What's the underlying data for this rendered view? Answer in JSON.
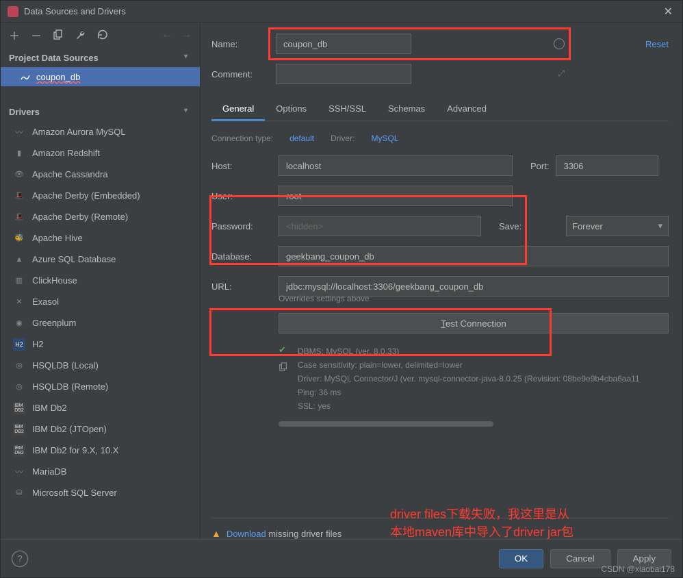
{
  "window": {
    "title": "Data Sources and Drivers"
  },
  "sidebar": {
    "sections": {
      "project": "Project Data Sources",
      "drivers": "Drivers"
    },
    "project_items": [
      {
        "label": "coupon_db"
      }
    ],
    "drivers_list": [
      {
        "label": "Amazon Aurora MySQL"
      },
      {
        "label": "Amazon Redshift"
      },
      {
        "label": "Apache Cassandra"
      },
      {
        "label": "Apache Derby (Embedded)"
      },
      {
        "label": "Apache Derby (Remote)"
      },
      {
        "label": "Apache Hive"
      },
      {
        "label": "Azure SQL Database"
      },
      {
        "label": "ClickHouse"
      },
      {
        "label": "Exasol"
      },
      {
        "label": "Greenplum"
      },
      {
        "label": "H2"
      },
      {
        "label": "HSQLDB (Local)"
      },
      {
        "label": "HSQLDB (Remote)"
      },
      {
        "label": "IBM Db2"
      },
      {
        "label": "IBM Db2 (JTOpen)"
      },
      {
        "label": "IBM Db2 for 9.X, 10.X"
      },
      {
        "label": "MariaDB"
      },
      {
        "label": "Microsoft SQL Server"
      }
    ]
  },
  "form": {
    "name_label": "Name:",
    "name_value": "coupon_db",
    "comment_label": "Comment:",
    "reset": "Reset",
    "tabs": [
      "General",
      "Options",
      "SSH/SSL",
      "Schemas",
      "Advanced"
    ],
    "conn_type_label": "Connection type:",
    "conn_type_value": "default",
    "driver_label": "Driver:",
    "driver_value": "MySQL",
    "host_label": "Host:",
    "host_value": "localhost",
    "port_label": "Port:",
    "port_value": "3306",
    "user_label": "User:",
    "user_value": "root",
    "password_label": "Password:",
    "password_placeholder": "<hidden>",
    "save_label": "Save:",
    "save_value": "Forever",
    "database_label": "Database:",
    "database_value": "geekbang_coupon_db",
    "url_label": "URL:",
    "url_value": "jdbc:mysql://localhost:3306/geekbang_coupon_db",
    "url_hint": "Overrides settings above",
    "test_btn_prefix": "T",
    "test_btn_rest": "est Connection",
    "status": {
      "dbms": "DBMS: MySQL (ver. 8.0.33)",
      "case": "Case sensitivity: plain=lower, delimited=lower",
      "driver": "Driver: MySQL Connector/J (ver. mysql-connector-java-8.0.25 (Revision: 08be9e9b4cba6aa11",
      "ping": "Ping: 36 ms",
      "ssl": "SSL: yes"
    },
    "download_link": "Download",
    "download_rest": " missing driver files"
  },
  "footer": {
    "ok": "OK",
    "cancel": "Cancel",
    "apply": "Apply"
  },
  "annotation": {
    "line1": "driver files下载失败，我这里是从",
    "line2": "本地maven库中导入了driver jar包"
  },
  "watermark": "CSDN @xiaobai178"
}
